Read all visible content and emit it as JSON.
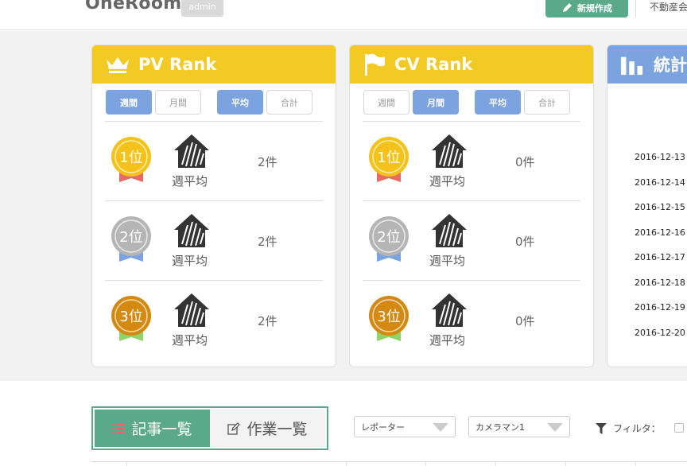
{
  "header": {
    "logo": "OneRoom",
    "user_badge": "admin",
    "new_button": "新規作成",
    "right_text": "不動産会"
  },
  "pv_card": {
    "title": "PV Rank",
    "icon": "crown-icon",
    "period_tabs": [
      "週間",
      "月間"
    ],
    "period_active": "週間",
    "agg_tabs": [
      "平均",
      "合計"
    ],
    "agg_active": "平均",
    "rows": [
      {
        "rank": "1位",
        "label": "週平均",
        "count": "2件"
      },
      {
        "rank": "2位",
        "label": "週平均",
        "count": "2件"
      },
      {
        "rank": "3位",
        "label": "週平均",
        "count": "2件"
      }
    ]
  },
  "cv_card": {
    "title": "CV Rank",
    "icon": "flag-icon",
    "period_tabs": [
      "週間",
      "月間"
    ],
    "period_active": "月間",
    "agg_tabs": [
      "平均",
      "合計"
    ],
    "agg_active": "平均",
    "rows": [
      {
        "rank": "1位",
        "label": "週平均",
        "count": "0件"
      },
      {
        "rank": "2位",
        "label": "週平均",
        "count": "0件"
      },
      {
        "rank": "3位",
        "label": "週平均",
        "count": "0件"
      }
    ]
  },
  "stats_card": {
    "title": "統計",
    "icon": "bar-chart-icon",
    "dates": [
      "2016-12-13",
      "2016-12-14",
      "2016-12-15",
      "2016-12-16",
      "2016-12-17",
      "2016-12-18",
      "2016-12-19",
      "2016-12-20"
    ]
  },
  "bottom": {
    "tab_articles": "記事一覧",
    "tab_tasks": "作業一覧",
    "reporter_select": "レポーター",
    "camera_select": "カメラマン1",
    "filter_label": "フィルタ："
  },
  "colors": {
    "yellow": "#f3ca24",
    "blue": "#7aa3e0",
    "green": "#5aa98b",
    "gold": "#f5c21a",
    "silver": "#b5b5b5",
    "bronze": "#d48a10"
  }
}
